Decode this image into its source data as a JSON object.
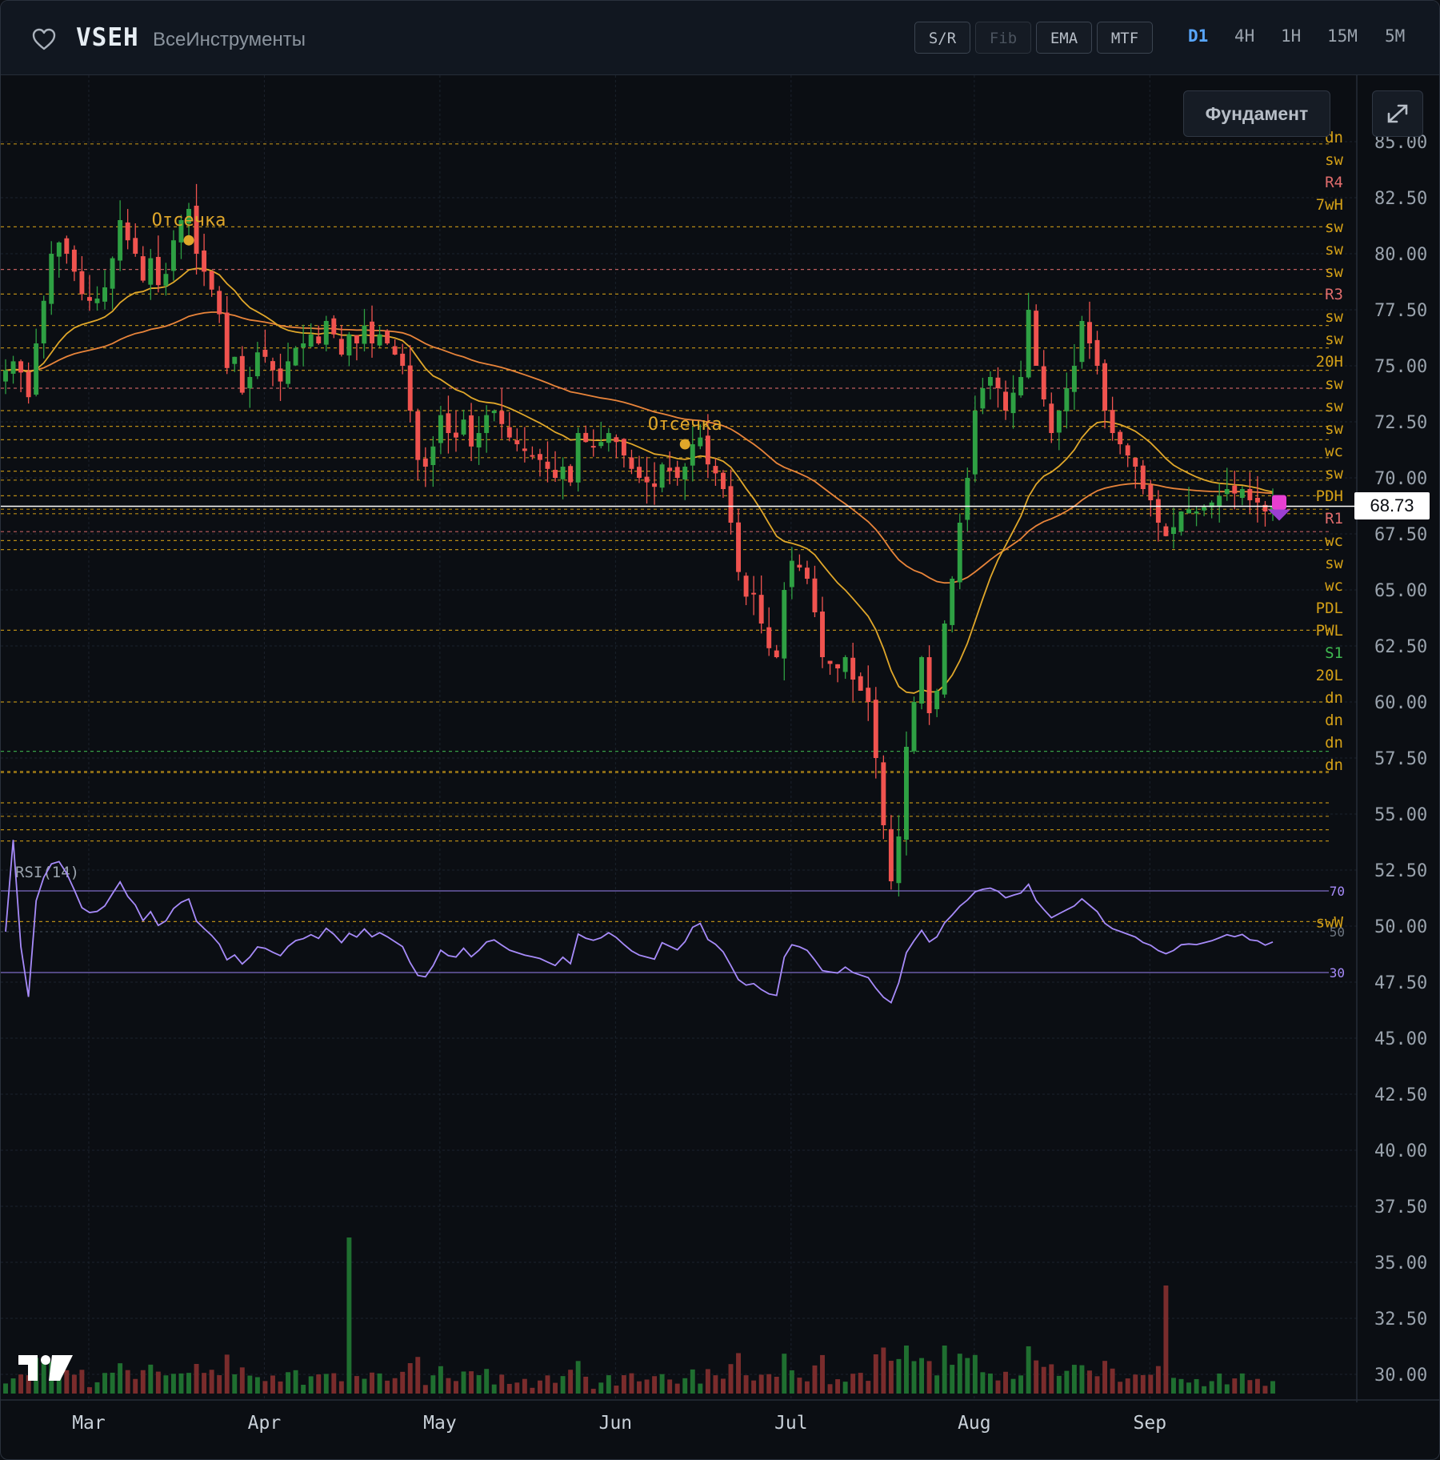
{
  "header": {
    "ticker": "VSEH",
    "company": "ВсеИнструменты",
    "toggles": [
      {
        "label": "S/R",
        "enabled": true
      },
      {
        "label": "Fib",
        "enabled": false
      },
      {
        "label": "EMA",
        "enabled": true
      },
      {
        "label": "MTF",
        "enabled": true
      }
    ],
    "timeframes": [
      {
        "label": "D1",
        "active": true
      },
      {
        "label": "4H",
        "active": false
      },
      {
        "label": "1H",
        "active": false
      },
      {
        "label": "15M",
        "active": false
      },
      {
        "label": "5M",
        "active": false
      }
    ]
  },
  "buttons": {
    "fundament": "Фундамент"
  },
  "last_price": "68.73",
  "rsi_label": "RSI(14)",
  "colors": {
    "up": "#2ea043",
    "down": "#f0534f",
    "level": "#d4a017",
    "rsi": "#a78bfa",
    "accent": "#58a6ff"
  },
  "chart_data": {
    "type": "candlestick",
    "title": "",
    "y_axis_ticks": [
      "85.00",
      "82.50",
      "80.00",
      "77.50",
      "75.00",
      "72.50",
      "70.00",
      "67.50",
      "65.00",
      "62.50",
      "60.00",
      "57.50",
      "55.00",
      "52.50",
      "50.00",
      "47.50",
      "45.00",
      "42.50",
      "40.00",
      "37.50",
      "35.00",
      "32.50",
      "30.00"
    ],
    "x_axis_labels": [
      "Mar",
      "Apr",
      "May",
      "Jun",
      "Jul",
      "Aug",
      "Sep"
    ],
    "ylim": [
      29.0,
      86.5
    ],
    "close": [
      74.8,
      75.2,
      74.7,
      73.6,
      76.0,
      77.9,
      80.0,
      80.5,
      80.0,
      79.2,
      78.2,
      77.9,
      78.0,
      78.5,
      79.8,
      81.5,
      80.6,
      80.0,
      78.8,
      79.8,
      78.6,
      79.1,
      80.6,
      81.5,
      82.0,
      80.0,
      79.2,
      78.4,
      77.3,
      74.9,
      75.4,
      73.8,
      74.5,
      75.6,
      75.4,
      74.8,
      74.3,
      75.2,
      75.8,
      76.0,
      76.4,
      76.0,
      77.0,
      76.4,
      75.5,
      76.4,
      76.0,
      76.8,
      76.0,
      76.4,
      76.0,
      75.5,
      75.0,
      73.0,
      70.8,
      70.5,
      71.4,
      72.8,
      72.0,
      71.8,
      72.6,
      71.4,
      72.0,
      72.8,
      73.0,
      72.4,
      71.8,
      71.5,
      71.2,
      71.0,
      70.8,
      70.4,
      70.0,
      70.5,
      69.8,
      72.0,
      71.6,
      71.4,
      71.6,
      72.0,
      71.6,
      71.0,
      70.4,
      70.0,
      69.8,
      69.6,
      70.6,
      70.3,
      70.0,
      70.5,
      71.5,
      71.8,
      70.6,
      70.2,
      69.5,
      68.0,
      65.8,
      64.7,
      64.8,
      63.5,
      62.4,
      62.0,
      65.0,
      66.3,
      66.0,
      65.5,
      64.0,
      62.0,
      61.7,
      61.5,
      62.0,
      61.0,
      60.5,
      60.0,
      57.5,
      54.5,
      52.0,
      54.0,
      58.0,
      60.0,
      62.0,
      59.5,
      60.5,
      63.5,
      65.5,
      68.0,
      70.0,
      73.0,
      74.0,
      74.5,
      74.0,
      73.0,
      73.8,
      74.5,
      77.5,
      75.0,
      73.5,
      72.0,
      73.0,
      74.0,
      75.0,
      77.0,
      76.0,
      75.0,
      73.0,
      72.0,
      71.5,
      71.0,
      70.5,
      69.5,
      69.0,
      68.0,
      67.4,
      67.8,
      68.5,
      68.6,
      68.5,
      68.7,
      68.9,
      69.2,
      69.5,
      69.3,
      69.5,
      69.0,
      68.9,
      68.5,
      68.73
    ],
    "ema_fast_last": 69.3,
    "ema_slow_last": 71.9,
    "levels": [
      {
        "label": "dn",
        "price": 84.9
      },
      {
        "label": "sw",
        "price": 81.2
      },
      {
        "label": "R4",
        "price": 79.3
      },
      {
        "label": "7wH",
        "price": 78.2
      },
      {
        "label": "sw",
        "price": 76.8
      },
      {
        "label": "sw",
        "price": 75.8
      },
      {
        "label": "sw",
        "price": 74.8
      },
      {
        "label": "R3",
        "price": 74.0
      },
      {
        "label": "sw",
        "price": 73.0
      },
      {
        "label": "sw",
        "price": 72.3
      },
      {
        "label": "20H",
        "price": 71.7
      },
      {
        "label": "sw",
        "price": 70.9
      },
      {
        "label": "sw",
        "price": 70.3
      },
      {
        "label": "sw",
        "price": 69.9
      },
      {
        "label": "wc",
        "price": 69.2
      },
      {
        "label": "sw",
        "price": 68.6
      },
      {
        "label": "PDH",
        "price": 68.4
      },
      {
        "label": "R1",
        "price": 67.6
      },
      {
        "label": "wc",
        "price": 67.2
      },
      {
        "label": "sw",
        "price": 66.8
      },
      {
        "label": "wc",
        "price": 63.2
      },
      {
        "label": "PDL",
        "price": 60.0
      },
      {
        "label": "PWL",
        "price": 56.9
      },
      {
        "label": "S1",
        "price": 57.8
      },
      {
        "label": "20L",
        "price": 56.85
      },
      {
        "label": "dn",
        "price": 55.5
      },
      {
        "label": "dn",
        "price": 54.9
      },
      {
        "label": "dn",
        "price": 54.3
      },
      {
        "label": "dn",
        "price": 53.8
      },
      {
        "label": "swW",
        "price": 50.2
      }
    ],
    "annotations": [
      {
        "text": "Отсечка",
        "near": "late March"
      },
      {
        "text": "Отсечка",
        "near": "mid June"
      }
    ],
    "rsi": {
      "levels": [
        70,
        50,
        30
      ]
    }
  }
}
